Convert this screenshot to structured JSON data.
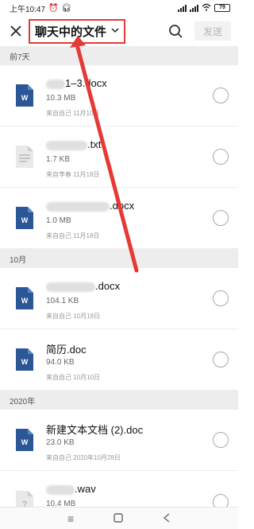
{
  "status_bar": {
    "time": "上午10:47",
    "battery": "79"
  },
  "header": {
    "title": "聊天中的文件",
    "send_label": "发送"
  },
  "sections": {
    "week": "前7天",
    "oct": "10月",
    "year2020": "2020年"
  },
  "files": [
    {
      "name": "1–3.docx",
      "size": "10.3 MB",
      "meta": "来自自己  11月10日",
      "icon": "word-icon"
    },
    {
      "name": ".txt",
      "size": "1.7 KB",
      "meta": "来自李春  11月18日",
      "icon": "text-file-icon"
    },
    {
      "name": ".docx",
      "size": "1.0 MB",
      "meta": "来自自己  11月18日",
      "icon": "word-icon"
    },
    {
      "name": ".docx",
      "size": "104.1 KB",
      "meta": "来自自己  10月18日",
      "icon": "word-icon"
    },
    {
      "name": "简历.doc",
      "size": "94.0 KB",
      "meta": "来自自己  10月10日",
      "icon": "word-icon"
    },
    {
      "name": "新建文本文档 (2).doc",
      "size": "23.0 KB",
      "meta": "来自自己  2020年10月28日",
      "icon": "word-icon"
    },
    {
      "name": ".wav",
      "size": "10.4 MB",
      "meta": "",
      "icon": "audio-file-icon"
    }
  ],
  "colors": {
    "word_blue": "#2b5797",
    "highlight_red": "#e53935"
  }
}
